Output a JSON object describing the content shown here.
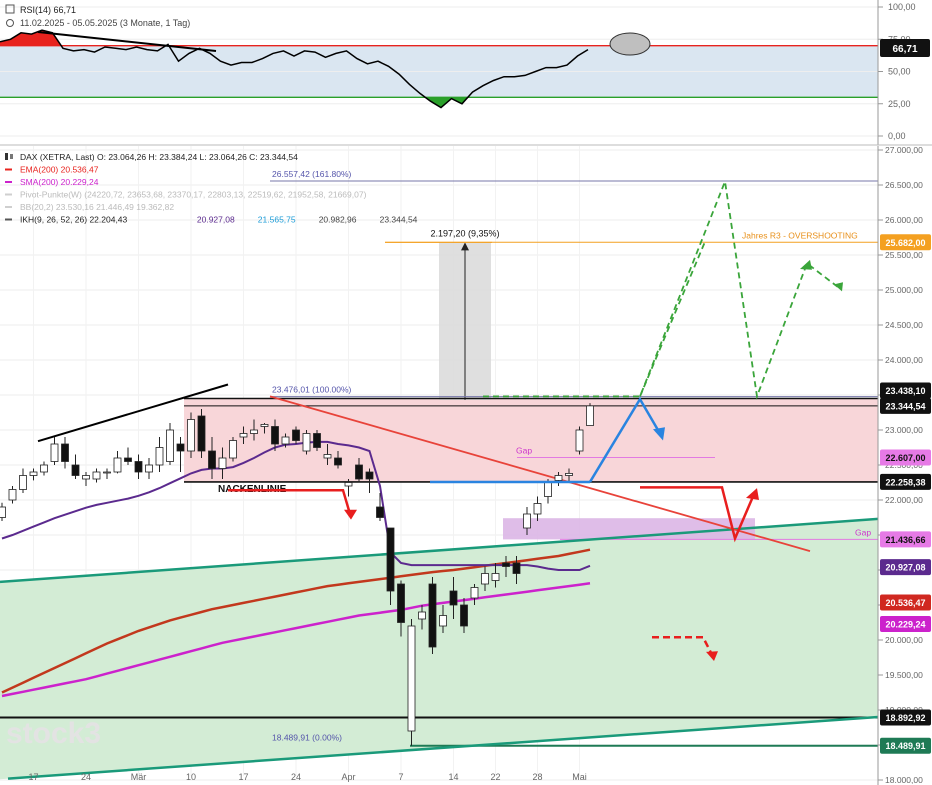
{
  "chart_data": [
    {
      "type": "line",
      "panel": "rsi",
      "title": "RSI(14) 66,71",
      "subtitle": "11.02.2025 - 05.05.2025   (3 Monate, 1 Tag)",
      "ylim": [
        0,
        100
      ],
      "yticks": [
        "100,00",
        "75,00",
        "50,00",
        "25,00",
        "0,00"
      ],
      "upper_level": 70,
      "lower_level": 30,
      "current_badge": "66,71",
      "series": [
        {
          "x": [
            0,
            1,
            2,
            3,
            4,
            5,
            6,
            7,
            8,
            9,
            10,
            11,
            12,
            13,
            14,
            15,
            16,
            17,
            18,
            19,
            20,
            21,
            22,
            23,
            24,
            25,
            26,
            27,
            28,
            29,
            30,
            31,
            32,
            33,
            34,
            35,
            36,
            37,
            38,
            39,
            40,
            41,
            42,
            43,
            44,
            45,
            46,
            47,
            48,
            49,
            50,
            51,
            52,
            53,
            54,
            55,
            56
          ],
          "values": [
            73,
            75,
            80,
            79,
            82,
            80,
            68,
            66,
            67,
            65,
            69,
            68,
            67,
            69,
            67,
            66,
            71,
            58,
            64,
            68,
            64,
            58,
            55,
            57,
            57,
            60,
            64,
            66,
            62,
            66,
            65,
            61,
            64,
            66,
            60,
            56,
            58,
            54,
            48,
            40,
            33,
            27,
            22,
            29,
            25,
            34,
            39,
            43,
            46,
            46,
            47,
            50,
            53,
            53,
            55,
            62,
            67
          ]
        }
      ],
      "trendline_label": ""
    },
    {
      "type": "candlestick",
      "panel": "price",
      "legend": [
        {
          "label": "DAX (XETRA, Last)  O: 23.064,26   H: 23.384,24   L: 23.064,26   C: 23.344,54",
          "color": "#000000",
          "icon": "candles-icon"
        },
        {
          "label": "EMA(200)  20.536,47",
          "color": "#e8231e"
        },
        {
          "label": "SMA(200)  20.229,24",
          "color": "#cc22cc"
        },
        {
          "label": "Pivot-Punkte(W)  (24220,72,  23653,68,  23370,17,  22803,13,  22519,62,  21952,58,  21669,07)",
          "color": "#cfcfcf"
        },
        {
          "label": "BB(20,2)  23.530,16   21.446,49   19.362,82",
          "color": "#cfcfcf"
        },
        {
          "label": "IKH(9, 26, 52, 26)  22.204,43",
          "color": "#555555",
          "extra": [
            {
              "text": "20.927,08",
              "color": "#5b2a8e"
            },
            {
              "text": "21.565,75",
              "color": "#1a9bd7"
            },
            {
              "text": "20.982,96",
              "color": "#444444"
            },
            {
              "text": "23.344,54",
              "color": "#444444"
            }
          ]
        }
      ],
      "ylim": [
        18000,
        27000
      ],
      "yticks": [
        "27.000,00",
        "26.500,00",
        "26.000,00",
        "25.500,00",
        "25.000,00",
        "24.500,00",
        "24.000,00",
        "23.500,00",
        "23.000,00",
        "22.500,00",
        "22.000,00",
        "21.500,00",
        "21.000,00",
        "20.500,00",
        "20.000,00",
        "19.500,00",
        "19.000,00",
        "18.500,00",
        "18.000,00"
      ],
      "xticks": [
        {
          "label": "17",
          "x": 3
        },
        {
          "label": "24",
          "x": 8
        },
        {
          "label": "Mär",
          "x": 13
        },
        {
          "label": "10",
          "x": 18
        },
        {
          "label": "17",
          "x": 23
        },
        {
          "label": "24",
          "x": 28
        },
        {
          "label": "Apr",
          "x": 33
        },
        {
          "label": "7",
          "x": 38
        },
        {
          "label": "14",
          "x": 43
        },
        {
          "label": "22",
          "x": 47
        },
        {
          "label": "28",
          "x": 51
        },
        {
          "label": "Mai",
          "x": 55
        }
      ],
      "candles": [
        [
          21750,
          21960,
          21700,
          21900
        ],
        [
          22000,
          22200,
          21950,
          22150
        ],
        [
          22150,
          22450,
          22100,
          22350
        ],
        [
          22350,
          22450,
          22280,
          22400
        ],
        [
          22400,
          22550,
          22350,
          22500
        ],
        [
          22550,
          22900,
          22500,
          22800
        ],
        [
          22800,
          22900,
          22450,
          22550
        ],
        [
          22500,
          22650,
          22300,
          22350
        ],
        [
          22300,
          22400,
          22200,
          22350
        ],
        [
          22300,
          22450,
          22250,
          22400
        ],
        [
          22400,
          22450,
          22300,
          22400
        ],
        [
          22400,
          22700,
          22380,
          22600
        ],
        [
          22600,
          22750,
          22500,
          22550
        ],
        [
          22550,
          22650,
          22300,
          22400
        ],
        [
          22400,
          22600,
          22300,
          22500
        ],
        [
          22500,
          22900,
          22400,
          22750
        ],
        [
          22550,
          23100,
          22500,
          23000
        ],
        [
          22800,
          22900,
          22400,
          22700
        ],
        [
          22700,
          23250,
          22600,
          23150
        ],
        [
          23200,
          23300,
          22600,
          22700
        ],
        [
          22700,
          22900,
          22300,
          22450
        ],
        [
          22450,
          22750,
          22300,
          22600
        ],
        [
          22600,
          22900,
          22550,
          22850
        ],
        [
          22900,
          23050,
          22800,
          22950
        ],
        [
          22950,
          23150,
          22850,
          23000
        ],
        [
          23050,
          23100,
          22950,
          23080
        ],
        [
          23050,
          23150,
          22700,
          22800
        ],
        [
          22800,
          22950,
          22750,
          22900
        ],
        [
          23000,
          23050,
          22800,
          22850
        ],
        [
          22700,
          23000,
          22650,
          22950
        ],
        [
          22950,
          23000,
          22700,
          22750
        ],
        [
          22600,
          22800,
          22500,
          22650
        ],
        [
          22600,
          22700,
          22450,
          22500
        ],
        [
          22200,
          22300,
          22050,
          22250
        ],
        [
          22500,
          22600,
          22250,
          22300
        ],
        [
          22400,
          22450,
          22100,
          22300
        ],
        [
          21900,
          22100,
          21700,
          21750
        ],
        [
          21600,
          21300,
          20500,
          20700
        ],
        [
          20800,
          20850,
          20050,
          20250
        ],
        [
          18700,
          20300,
          18490,
          20200
        ],
        [
          20300,
          20500,
          20150,
          20400
        ],
        [
          20800,
          20900,
          19800,
          19900
        ],
        [
          20200,
          20500,
          20100,
          20350
        ],
        [
          20700,
          20900,
          20300,
          20500
        ],
        [
          20500,
          20600,
          20100,
          20200
        ],
        [
          20600,
          20800,
          20500,
          20750
        ],
        [
          20800,
          21050,
          20700,
          20950
        ],
        [
          20850,
          21100,
          20750,
          20950
        ],
        [
          21100,
          21200,
          20900,
          21050
        ],
        [
          21100,
          21200,
          20800,
          20950
        ],
        [
          21600,
          21900,
          21500,
          21800
        ],
        [
          21800,
          22050,
          21700,
          21950
        ],
        [
          22050,
          22300,
          21950,
          22250
        ],
        [
          22280,
          22400,
          22200,
          22350
        ],
        [
          22350,
          22450,
          22250,
          22380
        ],
        [
          22700,
          23050,
          22650,
          23000
        ],
        [
          23064.26,
          23384.24,
          23064.26,
          23344.54
        ]
      ],
      "ema200": [
        19250,
        19320,
        19390,
        19460,
        19530,
        19600,
        19670,
        19740,
        19810,
        19880,
        19950,
        20010,
        20070,
        20130,
        20180,
        20230,
        20280,
        20320,
        20360,
        20400,
        20440,
        20470,
        20500,
        20530,
        20560,
        20590,
        20620,
        20650,
        20680,
        20710,
        20740,
        20770,
        20790,
        20810,
        20830,
        20850,
        20870,
        20890,
        20910,
        20930,
        20950,
        20970,
        20985,
        21000,
        21020,
        21040,
        21060,
        21080,
        21100,
        21120,
        21140,
        21160,
        21180,
        21200,
        21230,
        21260,
        21290
      ],
      "sma200": [
        19200,
        19230,
        19260,
        19290,
        19320,
        19350,
        19380,
        19410,
        19440,
        19480,
        19520,
        19560,
        19600,
        19640,
        19680,
        19720,
        19760,
        19800,
        19840,
        19880,
        19920,
        19960,
        19990,
        20020,
        20050,
        20080,
        20110,
        20140,
        20170,
        20200,
        20230,
        20260,
        20290,
        20320,
        20350,
        20370,
        20390,
        20410,
        20430,
        20460,
        20490,
        20510,
        20530,
        20550,
        20570,
        20590,
        20610,
        20630,
        20650,
        20670,
        20690,
        20710,
        20730,
        20750,
        20770,
        20790,
        20810
      ],
      "ikh_purple": [
        21450,
        21500,
        21560,
        21620,
        21680,
        21740,
        21790,
        21840,
        21890,
        21930,
        21960,
        21990,
        22020,
        22060,
        22110,
        22170,
        22240,
        22310,
        22380,
        22430,
        22450,
        22450,
        22470,
        22530,
        22600,
        22680,
        22750,
        22790,
        22800,
        22820,
        22830,
        22830,
        22800,
        22780,
        22750,
        22700,
        22200,
        21250,
        21100,
        21070,
        21070,
        21070,
        21070,
        21070,
        21070,
        21070,
        21070,
        21070,
        21070,
        21070,
        21070,
        21050,
        21020,
        21000,
        21000,
        21000,
        21060
      ],
      "levels": [
        {
          "value": 26557.42,
          "label": "26.557,42 (161.80%)",
          "color": "#7777aa"
        },
        {
          "value": 25682.0,
          "label": "Jahres R3 - OVERSHOOTING",
          "badge": "25.682,00",
          "color": "#f4a020"
        },
        {
          "value": 23476.01,
          "label": "23.476,01 (100.00%)",
          "color": "#7777aa"
        },
        {
          "value": 23450.0,
          "badge": "23.438,10",
          "color": "#111111"
        },
        {
          "value": 23344.54,
          "badge": "23.344,54",
          "color": "#111111"
        },
        {
          "value": 22607.0,
          "label": "Gap",
          "badge": "22.607,00",
          "color": "#e27ae2"
        },
        {
          "value": 22258.38,
          "label": "NACKENLINIE",
          "badge": "22.258,38",
          "color": "#111111"
        },
        {
          "value": 21436.66,
          "label": "Gap",
          "badge": "21.436,66",
          "color": "#e27ae2"
        },
        {
          "value": 20927.08,
          "badge": "20.927,08",
          "color": "#5b2a8e"
        },
        {
          "value": 20536.47,
          "badge": "20.536,47",
          "color": "#c2381d"
        },
        {
          "value": 20229.24,
          "badge": "20.229,24",
          "color": "#cc22cc"
        },
        {
          "value": 18892.92,
          "badge": "18.892,92",
          "color": "#111111"
        },
        {
          "value": 18489.91,
          "label": "18.489,91 (0.00%)",
          "badge": "18.489,91",
          "color": "#1e7a55"
        }
      ],
      "annotations": [
        {
          "text": "2.197,20 (9,35%)",
          "kind": "measure-box"
        }
      ],
      "watermark": "stock3"
    }
  ]
}
